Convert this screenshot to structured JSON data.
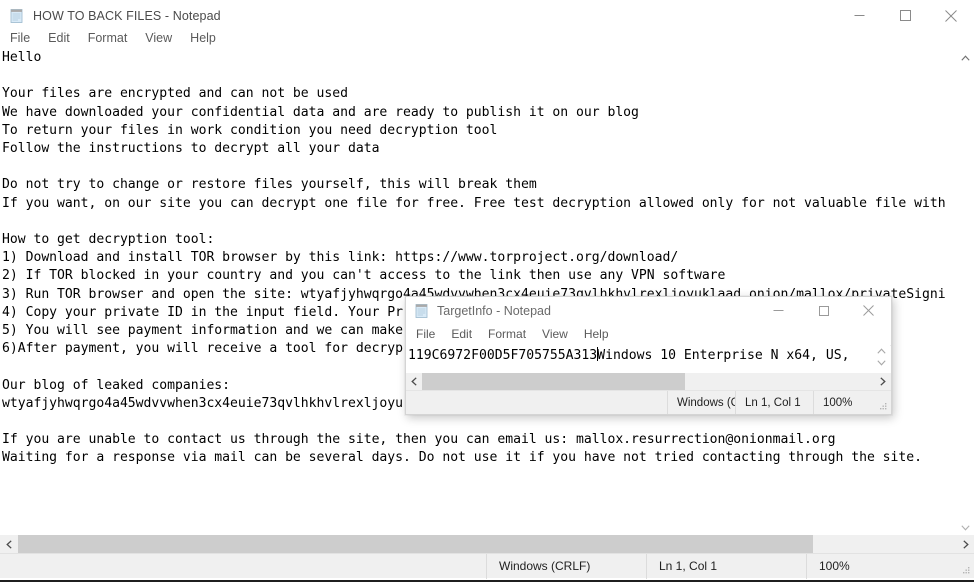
{
  "main_window": {
    "title": "HOW TO BACK FILES - Notepad",
    "icon": "notepad-icon",
    "menu": [
      "File",
      "Edit",
      "Format",
      "View",
      "Help"
    ],
    "caption_buttons": [
      {
        "name": "minimize-button",
        "glyph": "minimize-icon"
      },
      {
        "name": "maximize-button",
        "glyph": "maximize-icon"
      },
      {
        "name": "close-button",
        "glyph": "close-icon"
      }
    ],
    "content": "Hello\n\nYour files are encrypted and can not be used\nWe have downloaded your confidential data and are ready to publish it on our blog\nTo return your files in work condition you need decryption tool\nFollow the instructions to decrypt all your data\n\nDo not try to change or restore files yourself, this will break them\nIf you want, on our site you can decrypt one file for free. Free test decryption allowed only for not valuable file with\n\nHow to get decryption tool:\n1) Download and install TOR browser by this link: https://www.torproject.org/download/\n2) If TOR blocked in your country and you can't access to the link then use any VPN software\n3) Run TOR browser and open the site: wtyafjyhwqrgo4a45wdvvwhen3cx4euie73qvlhkhvlrexljoyuklaad.onion/mallox/privateSigni\n4) Copy your private ID in the input field. Your Pr\n5) You will see payment information and we can make\n6)After payment, you will receive a tool for decryp                                              you\n\nOur blog of leaked companies:\nwtyafjyhwqrgo4a45wdvvwhen3cx4euie73qvlhkhvlrexljoyu\n\nIf you are unable to contact us through the site, then you can email us: mallox.resurrection@onionmail.org\nWaiting for a response via mail can be several days. Do not use it if you have not tried contacting through the site.",
    "statusbar": {
      "eol": "Windows (CRLF)",
      "position": "Ln 1, Col 1",
      "zoom": "100%"
    }
  },
  "inner_window": {
    "title": "TargetInfo - Notepad",
    "icon": "notepad-icon",
    "menu": [
      "File",
      "Edit",
      "Format",
      "View",
      "Help"
    ],
    "caption_buttons": [
      {
        "name": "minimize-button",
        "glyph": "minimize-icon"
      },
      {
        "name": "maximize-button",
        "glyph": "maximize-icon"
      },
      {
        "name": "close-button",
        "glyph": "close-icon"
      }
    ],
    "content_before_caret": "119C6972F00D5F705755A313",
    "content_after_caret": "Windows 10 Enterprise N x64, US,",
    "statusbar": {
      "eol": "Windows (CR",
      "position": "Ln 1, Col 1",
      "zoom": "100%"
    }
  },
  "colors": {
    "window_bg": "#ffffff",
    "chrome_bg": "#f0f0f0",
    "scroll_thumb": "#cdcdcd",
    "title_text": "#4b4b4b",
    "body_text": "#000000",
    "separator": "#dcdcdc"
  }
}
